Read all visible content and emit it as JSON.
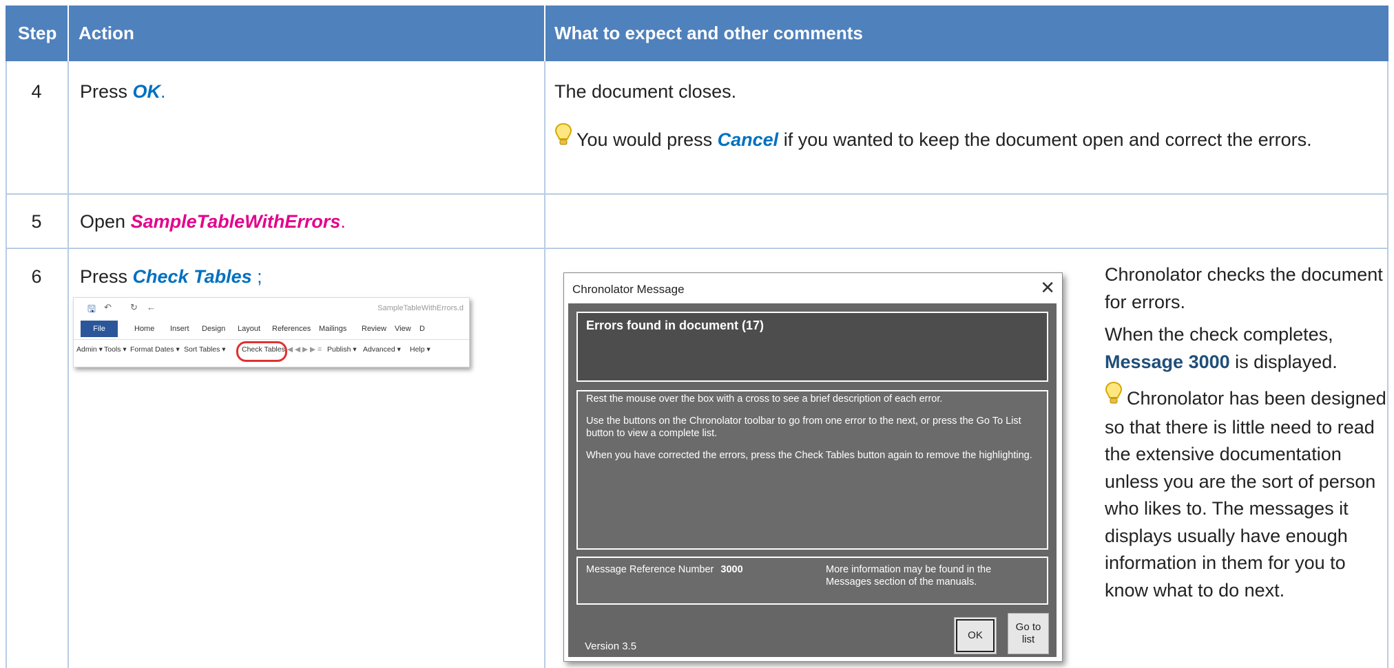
{
  "header": {
    "step": "Step",
    "action": "Action",
    "comments": "What to expect and other comments"
  },
  "row4": {
    "step": "4",
    "action_pre": "Press ",
    "action_em": "OK",
    "action_post": ".",
    "comment1": "The document closes.",
    "tip_pre": "You would press ",
    "tip_em": "Cancel",
    "tip_post": "  if you wanted to keep the document open and correct the errors."
  },
  "row5": {
    "step": "5",
    "action_pre": "Open ",
    "action_em": "SampleTableWithErrors",
    "action_post": "."
  },
  "row6": {
    "step": "6",
    "action_pre": "Press ",
    "action_em": "Check Tables",
    "action_post": " ;",
    "ribbon": {
      "doc_title": "SampleTableWithErrors.d",
      "tabs": [
        "File",
        "Home",
        "Insert",
        "Design",
        "Layout",
        "References",
        "Mailings",
        "Review",
        "View",
        "D"
      ],
      "toolbar": [
        "Admin ▾",
        "Tools ▾",
        "Format Dates ▾",
        "Sort Tables ▾",
        "Check Tables",
        "Publish ▾",
        "Advanced ▾",
        "Help ▾"
      ]
    },
    "dialog": {
      "title": "Chronolator Message",
      "heading": "Errors found in document (17)",
      "para1": "Rest the mouse over the box with a cross to see a brief description of each error.",
      "para2": "Use the buttons on the Chronolator toolbar to go from one error to the next, or press the Go To List button to view a complete list.",
      "para3": "When you have corrected the errors, press the Check Tables button again to remove the highlighting.",
      "ref_label": "Message Reference Number",
      "ref_number": "3000",
      "more_info": "More information may be found in the Messages section of the manuals.",
      "version": "Version 3.5",
      "ok": "OK",
      "go_to_list": "Go to list"
    },
    "side_p1": "Chronolator checks the document for errors.",
    "side_p2_pre": "When the check completes, ",
    "side_p2_em": "Message 3000",
    "side_p2_post": " is displayed.",
    "side_tip": "Chronolator has been designed so that there is little need to read the extensive documentation unless you are the sort of person who likes to. The messages it displays usually have enough information in them for you to know what to do next."
  },
  "colors": {
    "header_bg": "#4f81bd",
    "emphasis_blue": "#0070c0",
    "emphasis_pink": "#e3008c",
    "message_blue": "#1f4e79"
  }
}
